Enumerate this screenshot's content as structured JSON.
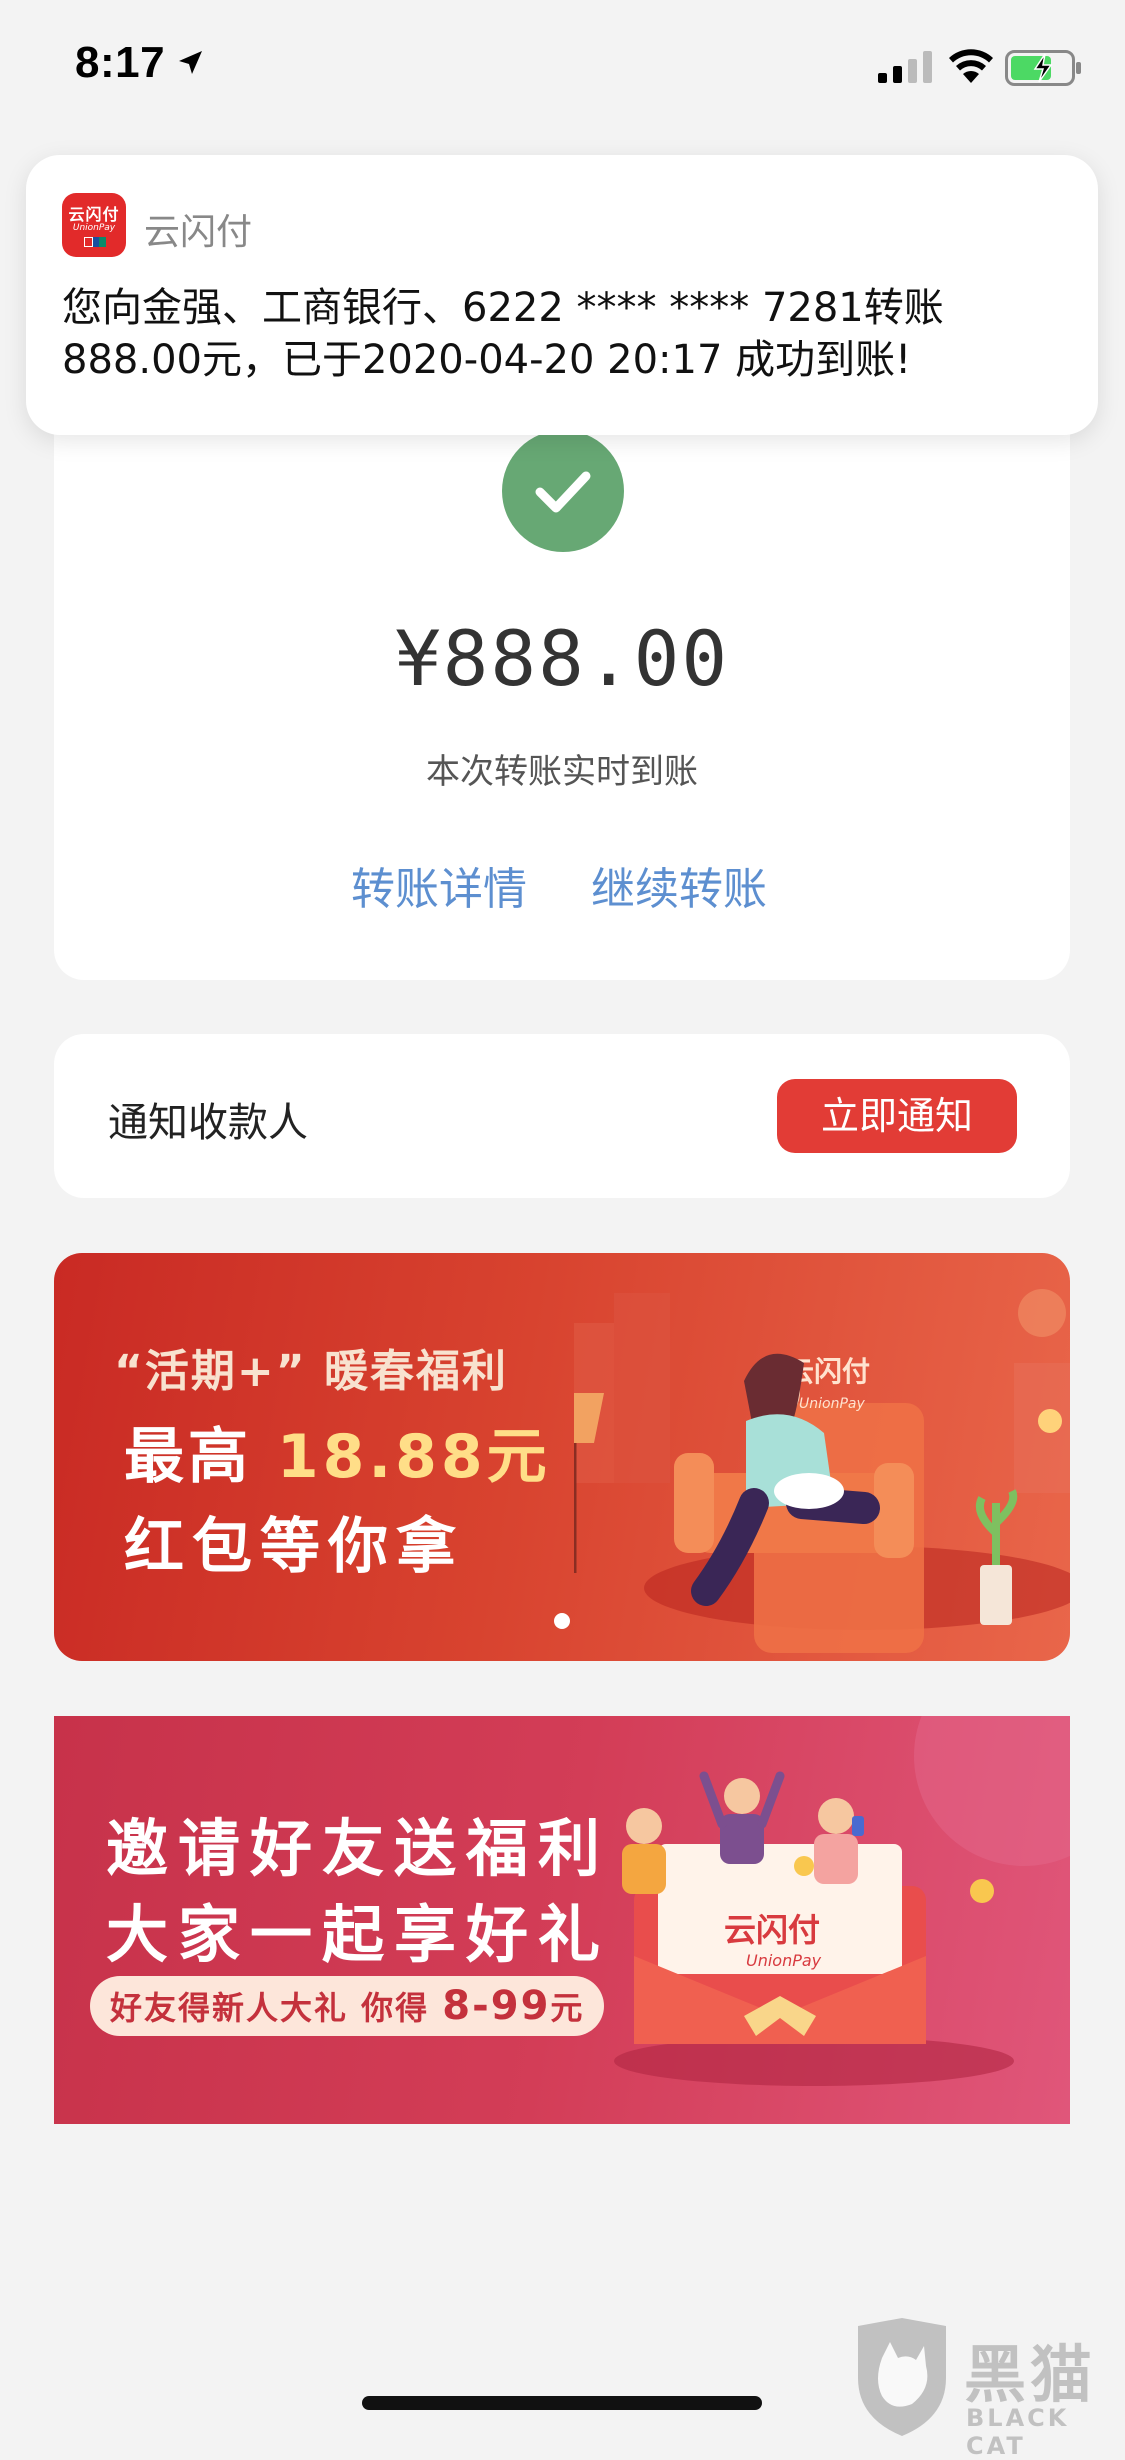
{
  "status_bar": {
    "time": "8:17"
  },
  "notification": {
    "app_name": "云闪付",
    "app_logo_text": "云闪付",
    "app_logo_sub": "UnionPay",
    "message": "您向金强、工商银行、6222 **** **** 7281转账888.00元，已于2020-04-20 20:17 成功到账!"
  },
  "result": {
    "amount": "¥888.00",
    "subtitle": "本次转账实时到账",
    "detail_link": "转账详情",
    "continue_link": "继续转账"
  },
  "notify_payee": {
    "label": "通知收款人",
    "button": "立即通知"
  },
  "banner1": {
    "subtitle": "“活期+”  暖春福利",
    "line2_prefix": "最高 ",
    "line2_amount": "18.88元",
    "line3": "红包等你拿",
    "logo_text": "云闪付",
    "logo_sub": "UnionPay"
  },
  "banner2": {
    "line1": "邀请好友送福利",
    "line2": "大家一起享好礼",
    "pill_prefix": "好友得新人大礼 你得 ",
    "pill_amount": "8-99",
    "pill_suffix": "元",
    "logo_text": "云闪付",
    "logo_sub": "UnionPay"
  },
  "watermark": {
    "title": "黑猫",
    "subtitle": "BLACK CAT"
  },
  "colors": {
    "accent_red": "#e23c36",
    "link_blue": "#5d8fd0",
    "success_green": "#67a874"
  }
}
